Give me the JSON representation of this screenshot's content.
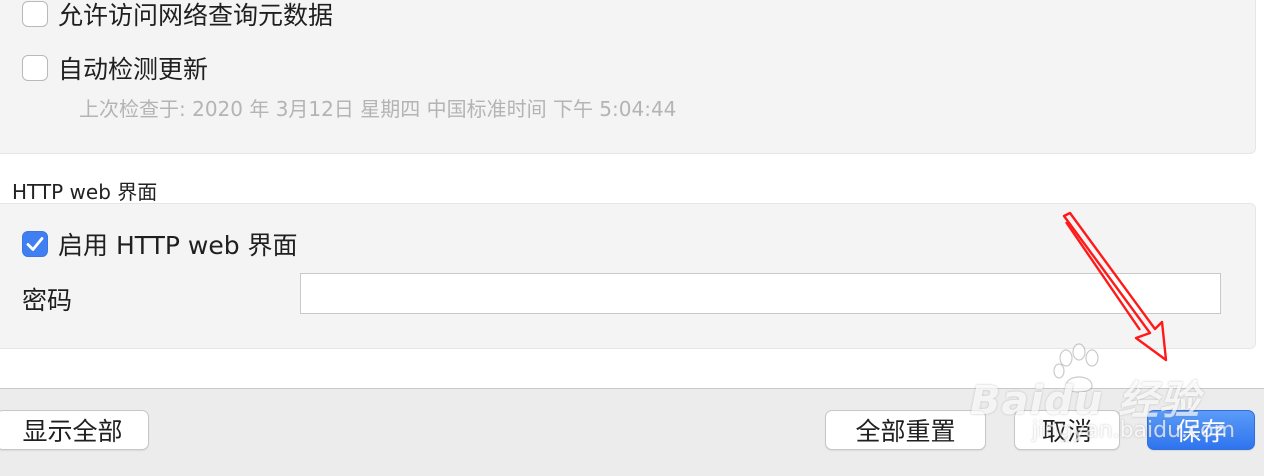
{
  "settings": {
    "allow_network_metadata_label": "允许访问网络查询元数据",
    "allow_network_metadata_checked": false,
    "auto_update_label": "自动检测更新",
    "auto_update_checked": false,
    "last_check_text": "上次检查于: 2020 年 3月12日 星期四 中国标准时间 下午 5:04:44"
  },
  "http_web": {
    "section_title": "HTTP web 界面",
    "enable_label": "启用 HTTP web 界面",
    "enable_checked": true,
    "password_label": "密码",
    "password_value": ""
  },
  "footer": {
    "show_all_label": "显示全部",
    "reset_all_label": "全部重置",
    "cancel_label": "取消",
    "save_label": "保存"
  },
  "watermark": {
    "brand_text": "Baidu 经验",
    "url_text": "jingyan.baidu.com"
  },
  "colors": {
    "accent": "#3f7ff2",
    "annotation_arrow": "#ff1a1a"
  }
}
